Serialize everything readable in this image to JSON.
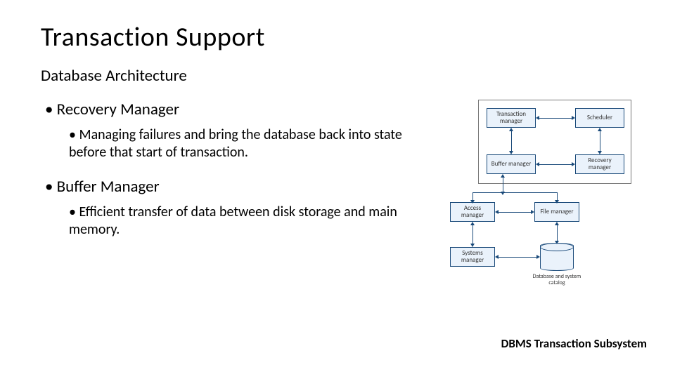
{
  "title": "Transaction Support",
  "subtitle": "Database Architecture",
  "sections": [
    {
      "heading": "Recovery Manager",
      "detail": "Managing failures and bring the database back into state before that start of transaction."
    },
    {
      "heading": "Buffer Manager",
      "detail": "Efficient transfer of data between disk storage and main memory."
    }
  ],
  "diagram": {
    "transaction_manager": "Transaction manager",
    "scheduler": "Scheduler",
    "buffer_manager": "Buffer manager",
    "recovery_manager": "Recovery manager",
    "access_manager": "Access manager",
    "file_manager": "File manager",
    "systems_manager": "Systems manager",
    "database_label": "Database and system catalog"
  },
  "caption": "DBMS Transaction Subsystem"
}
